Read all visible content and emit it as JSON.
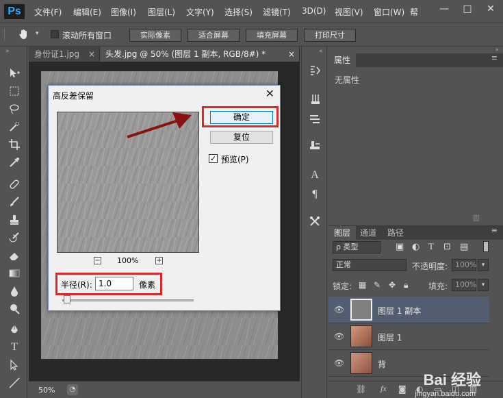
{
  "app": {
    "logo": "Ps"
  },
  "menu": [
    "文件(F)",
    "编辑(E)",
    "图像(I)",
    "图层(L)",
    "文字(Y)",
    "选择(S)",
    "滤镜(T)",
    "3D(D)",
    "视图(V)",
    "窗口(W)",
    "帮"
  ],
  "window_controls": {
    "minimize": "—",
    "restore": "□",
    "close": "✕"
  },
  "options": {
    "scroll_all": "滚动所有窗口",
    "actual_pixels": "实际像素",
    "fit_screen": "适合屏幕",
    "fill_screen": "填充屏幕",
    "print_size": "打印尺寸"
  },
  "tabs": [
    {
      "label": "身份证1.jpg",
      "close": "×"
    },
    {
      "label": "头发.jpg @ 50% (图层 1 副本, RGB/8#) *",
      "close": "×"
    }
  ],
  "status": {
    "zoom": "50%"
  },
  "dialog": {
    "title": "高反差保留",
    "close": "✕",
    "ok": "确定",
    "reset": "复位",
    "preview_label": "预览(P)",
    "preview_checked": "✓",
    "zoom_minus": "−",
    "zoom_plus": "+",
    "zoom": "100%",
    "radius_label": "半径(R):",
    "radius_value": "1.0",
    "radius_unit": "像素",
    "slider_level": 0.01
  },
  "properties": {
    "tab": "属性",
    "empty": "无属性"
  },
  "layers": {
    "tabs": [
      "图层",
      "通道",
      "路径"
    ],
    "filter_kind": "ρ 类型",
    "blend_mode": "正常",
    "opacity_label": "不透明度:",
    "opacity_value": "100%",
    "lock_label": "锁定:",
    "fill_label": "填充:",
    "fill_value": "100%",
    "items": [
      {
        "name": "图层 1 副本",
        "active": true,
        "thumb": "#808080"
      },
      {
        "name": "图层 1",
        "active": false,
        "thumb": "#b5795e"
      },
      {
        "name": "背",
        "active": false,
        "thumb": "#b27660"
      }
    ]
  },
  "watermark": {
    "brand": "Bai 经验",
    "url": "jingyan.baidu.com"
  }
}
